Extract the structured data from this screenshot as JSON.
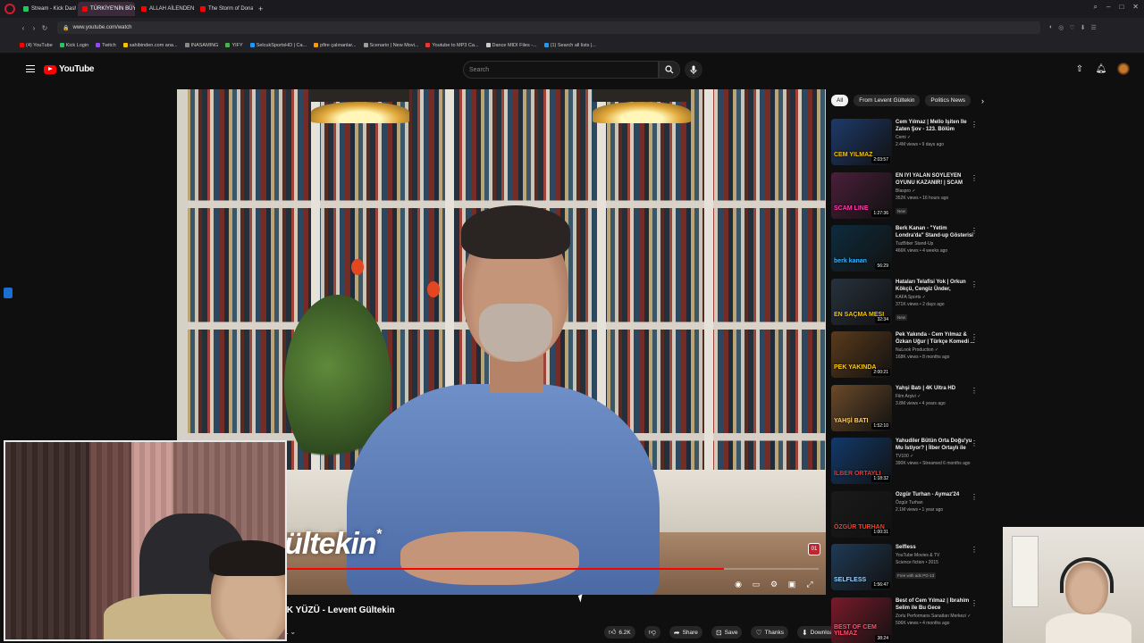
{
  "browser": {
    "tabs": [
      {
        "label": "Stream - Kick Dashb",
        "color": "#22c55e",
        "active": false
      },
      {
        "label": "TÜRKİYE'NİN BÜYÜ",
        "color": "#ff0000",
        "active": true
      },
      {
        "label": "ALLAH AİLENDEN VE AK",
        "color": "#ff0000",
        "active": false
      },
      {
        "label": "The Storm of Donald Trum",
        "color": "#ff0000",
        "active": false
      }
    ],
    "url": "www.youtube.com/watch",
    "bookmarks": [
      {
        "label": "(4) YouTube",
        "color": "#ff0000"
      },
      {
        "label": "Kick Login",
        "color": "#22c55e"
      },
      {
        "label": "Twitch",
        "color": "#9146ff"
      },
      {
        "label": "sahibinden.com ana...",
        "color": "#f5c400"
      },
      {
        "label": "INASAMING",
        "color": "#888888"
      },
      {
        "label": "YIFY",
        "color": "#4caf50"
      },
      {
        "label": "SelcukSportsHD | Ca...",
        "color": "#2196f3"
      },
      {
        "label": "pfire çalınanlar...",
        "color": "#ff9800"
      },
      {
        "label": "Scenario | New Movi...",
        "color": "#9e9e9e"
      },
      {
        "label": "Youtube to MP3 Ca...",
        "color": "#e53935"
      },
      {
        "label": "Dance MIDI Files -...",
        "color": "#cccccc"
      },
      {
        "label": "(1) Search all lists |...",
        "color": "#1d9bf0"
      }
    ]
  },
  "youtube": {
    "logo_text": "YouTube",
    "search_placeholder": "Search"
  },
  "player": {
    "lower_third": "ültekin",
    "lower_mark": "*",
    "progress_fraction": 0.85,
    "badge": "01"
  },
  "video": {
    "title": "IK YÜZÜ - Levent Gültekin",
    "channel_glyph": "L"
  },
  "actions": {
    "likes": "6.2K",
    "share": "Share",
    "save": "Save",
    "thanks": "Thanks",
    "download": "Download"
  },
  "chips": [
    {
      "label": "All",
      "active": true
    },
    {
      "label": "From Levent Gültekin",
      "active": false
    },
    {
      "label": "Politics News",
      "active": false
    }
  ],
  "recommendations": [
    {
      "title": "Cem Yılmaz | Mello İşiten İle Zaten Şov - 123. Bölüm",
      "channel": "Cemi ✓",
      "views": "2.4M views • 9 days ago",
      "duration": "2:03:57",
      "label": "CEM YILMAZ",
      "bg": "#1e3a6b",
      "accent": "#f5c400",
      "badge": ""
    },
    {
      "title": "EN İYİ YALAN SÖYLEYEN OYUNU KAZANIR! | SCAM LIN...",
      "channel": "Blaspro ✓",
      "views": "352K views • 16 hours ago",
      "duration": "1:27:36",
      "label": "SCAM LINE",
      "bg": "#4a1f3a",
      "accent": "#ff3cac",
      "badge": "New"
    },
    {
      "title": "Berk Kanan - \"Yetim Londra'da\" Stand-up Gösterisi | TuzBiber ...",
      "channel": "TuzBiber Stand-Up",
      "views": "466K views • 4 weeks ago",
      "duration": "56:29",
      "label": "berk kanan",
      "bg": "#0e2c3d",
      "accent": "#36b6ff",
      "badge": ""
    },
    {
      "title": "Hataları Telafisi Yok | Orkun Kökçü, Cengiz Ünder, Emirhan...",
      "channel": "KAFA Sports ✓",
      "views": "371K views • 2 days ago",
      "duration": "32:34",
      "label": "EN SAÇMA MESI",
      "bg": "#27323d",
      "accent": "#f5c400",
      "badge": "New"
    },
    {
      "title": "Pek Yakında - Cem Yılmaz & Özkan Uğur | Türkçe Komedi ...",
      "channel": "NuLook Production ✓",
      "views": "168K views • 8 months ago",
      "duration": "2:00:21",
      "label": "PEK YAKINDA",
      "bg": "#5a3b1b",
      "accent": "#ffcc00",
      "badge": ""
    },
    {
      "title": "Yahşi Batı | 4K Ultra HD",
      "channel": "Film Arşivi ✓",
      "views": "3.8M views • 4 years ago",
      "duration": "1:52:10",
      "label": "YAHŞİ BATI",
      "bg": "#6b4a2a",
      "accent": "#ffd27a",
      "badge": ""
    },
    {
      "title": "Yahudiler Bütün Orta Doğu'yu Mu İstiyor? | İlber Ortaylı ile Ö...",
      "channel": "TV100 ✓",
      "views": "390K views • Streamed 6 months ago",
      "duration": "1:18:32",
      "label": "İLBER ORTAYLI",
      "bg": "#123a6b",
      "accent": "#e53935",
      "badge": ""
    },
    {
      "title": "Özgür Turhan - Aymaz'24",
      "channel": "Özgür Turhan",
      "views": "2.1M views • 1 year ago",
      "duration": "1:00:31",
      "label": "ÖZGÜR TURHAN",
      "bg": "#1a1a1a",
      "accent": "#ff3b1f",
      "badge": ""
    },
    {
      "title": "Selfless",
      "channel": "YouTube Movies & TV",
      "views": "Science fiction • 2015",
      "duration": "1:56:47",
      "label": "SELFLESS",
      "bg": "#203a55",
      "accent": "#9fd4ff",
      "badge": "Free with ads  PG-13"
    },
    {
      "title": "Best of Cem Yılmaz | İbrahim Selim ile Bu Gece",
      "channel": "Zorlu Performans Sanatları Merkezi ✓",
      "views": "506K views • 4 months ago",
      "duration": "38:24",
      "label": "BEST OF CEM YILMAZ",
      "bg": "#7a1a2a",
      "accent": "#ff4d6d",
      "badge": ""
    }
  ],
  "colors": {
    "accent_red": "#ff0000",
    "background": "#0f0f0f",
    "chip_bg": "#272727"
  }
}
